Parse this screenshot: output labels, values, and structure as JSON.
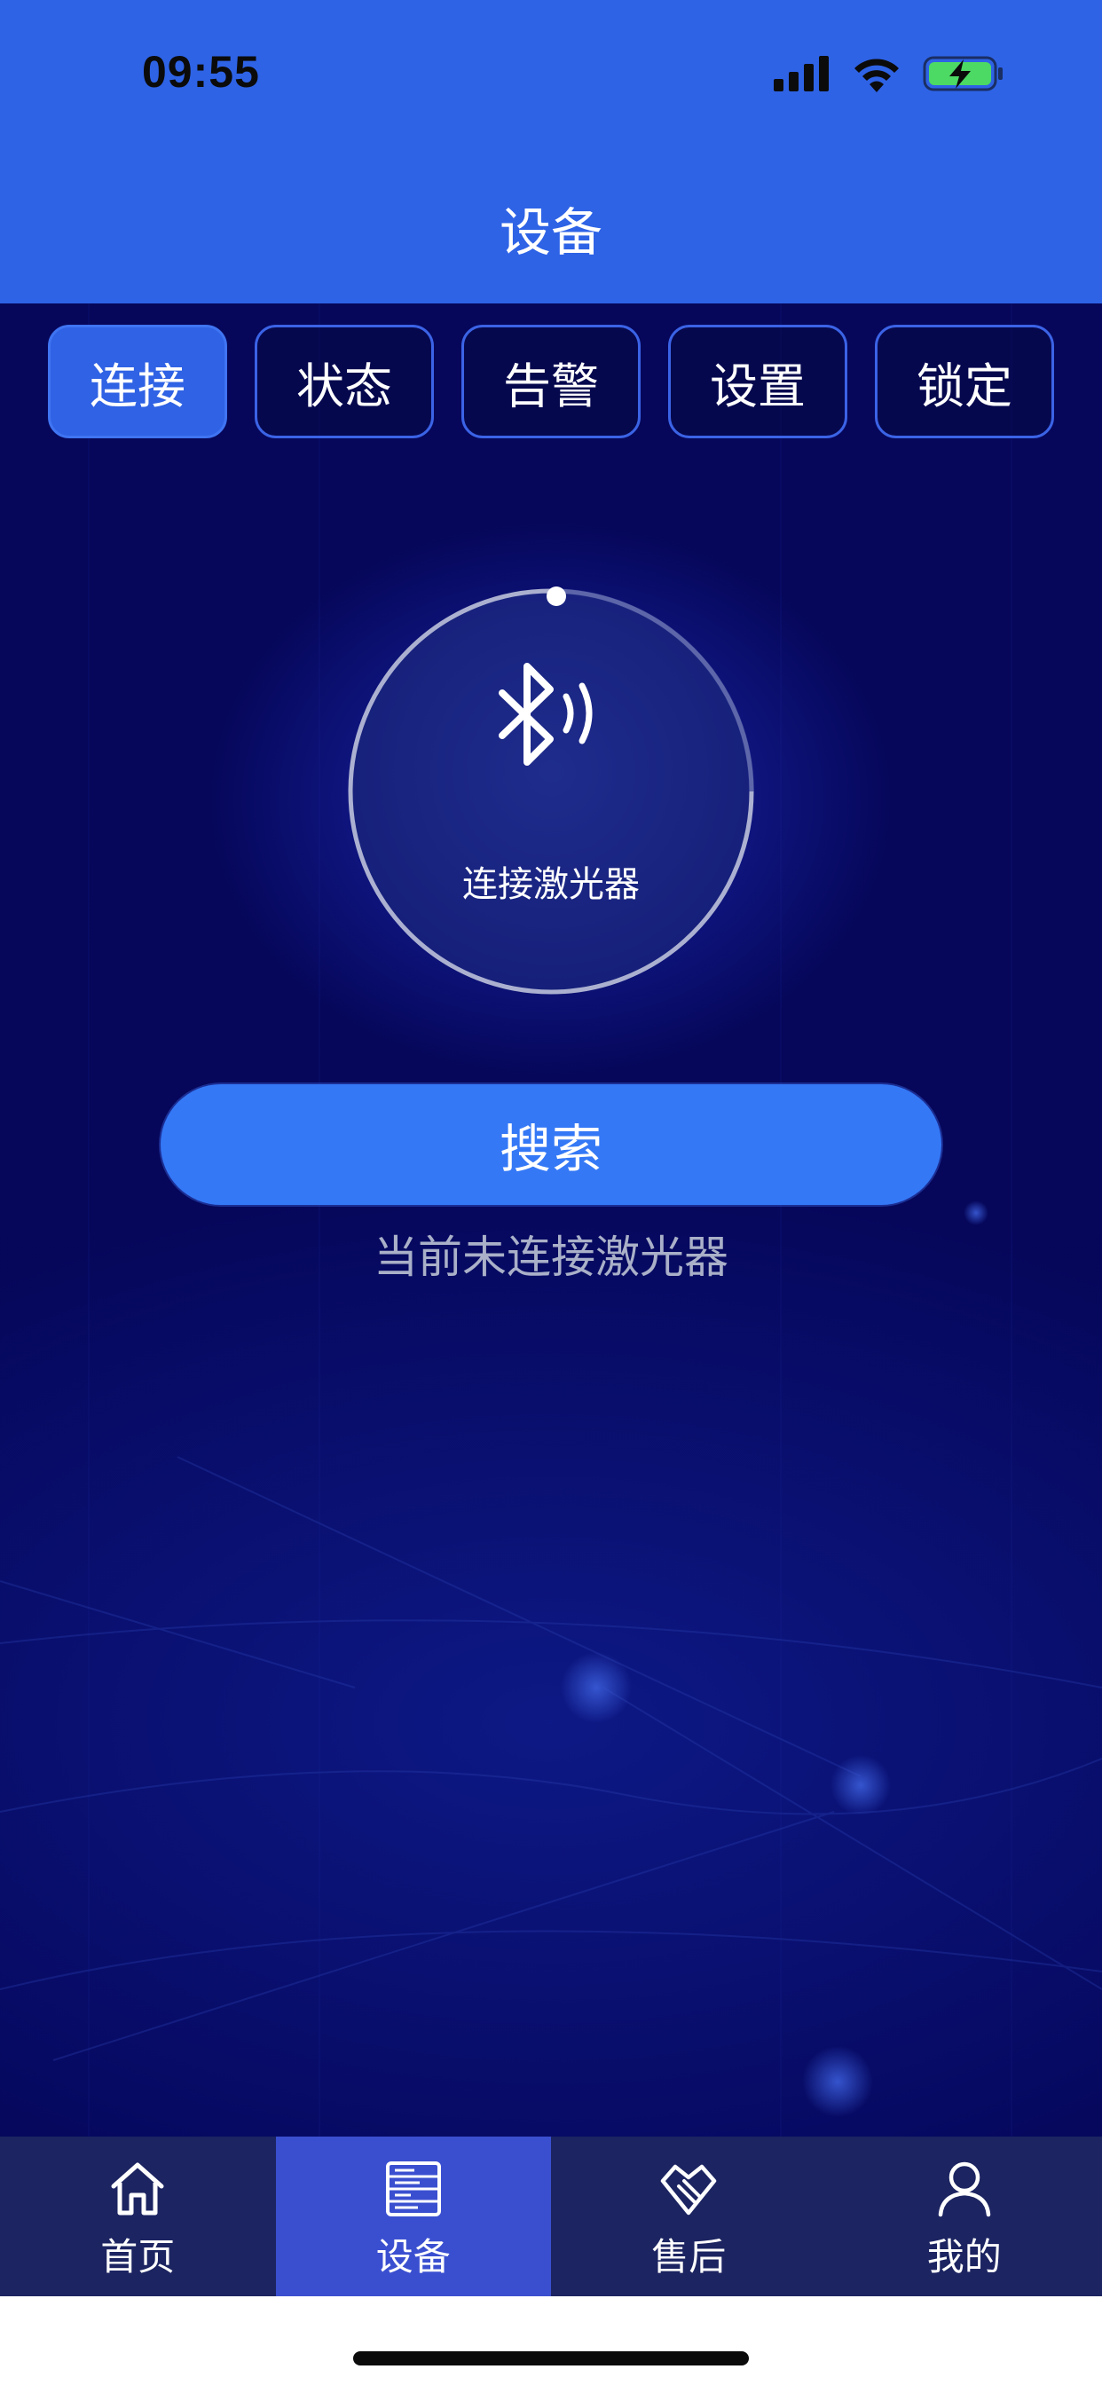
{
  "status_bar": {
    "time": "09:55"
  },
  "header": {
    "title": "设备"
  },
  "tabs": [
    {
      "label": "连接",
      "active": true
    },
    {
      "label": "状态",
      "active": false
    },
    {
      "label": "告警",
      "active": false
    },
    {
      "label": "设置",
      "active": false
    },
    {
      "label": "锁定",
      "active": false
    }
  ],
  "connect": {
    "icon": "bluetooth-icon",
    "label": "连接激光器",
    "search_label": "搜索",
    "status_text": "当前未连接激光器"
  },
  "tabbar": {
    "items": [
      {
        "label": "首页",
        "icon": "home-icon",
        "active": false
      },
      {
        "label": "设备",
        "icon": "device-icon",
        "active": true
      },
      {
        "label": "售后",
        "icon": "after-sales-icon",
        "active": false
      },
      {
        "label": "我的",
        "icon": "user-icon",
        "active": false
      }
    ]
  },
  "colors": {
    "header_blue": "#2e63e6",
    "background_navy": "#06075a",
    "button_blue": "#3478f6",
    "tabbar": "#1c2461",
    "tabbar_active": "#3a4fd0"
  }
}
